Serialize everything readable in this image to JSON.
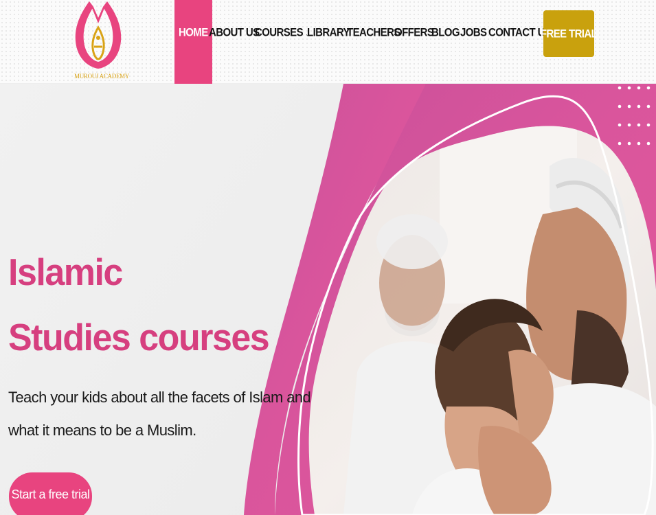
{
  "logo": {
    "text": "MUROUJ ACADEMY",
    "colors": {
      "pink": "#e8447f",
      "gold": "#d9a316"
    }
  },
  "nav": {
    "items": [
      {
        "label": "HOME",
        "active": true
      },
      {
        "label": "ABOUT US"
      },
      {
        "label": "COURSES",
        "has_dropdown": true,
        "chevron": "⌄"
      },
      {
        "label": "LIBRARY"
      },
      {
        "label": "TEACHERS"
      },
      {
        "label": "OFFERS"
      },
      {
        "label": "BLOG"
      },
      {
        "label": "JOBS"
      },
      {
        "label": "CONTACT US"
      }
    ],
    "free_trial_label": "FREE TRIAL"
  },
  "hero": {
    "title_line1": "Islamic",
    "title_line2": "Studies courses",
    "subtitle_line1": "Teach your kids about all the facets of Islam and",
    "subtitle_line2": "what it means to be a Muslim.",
    "cta_label": "Start a free trial",
    "image_icon": "photo-father-kissing-child-icon"
  },
  "colors": {
    "accent": "#e8447f",
    "title": "#d63f7f",
    "gold_button": "#c9a10d",
    "purple": "#a9559a"
  }
}
